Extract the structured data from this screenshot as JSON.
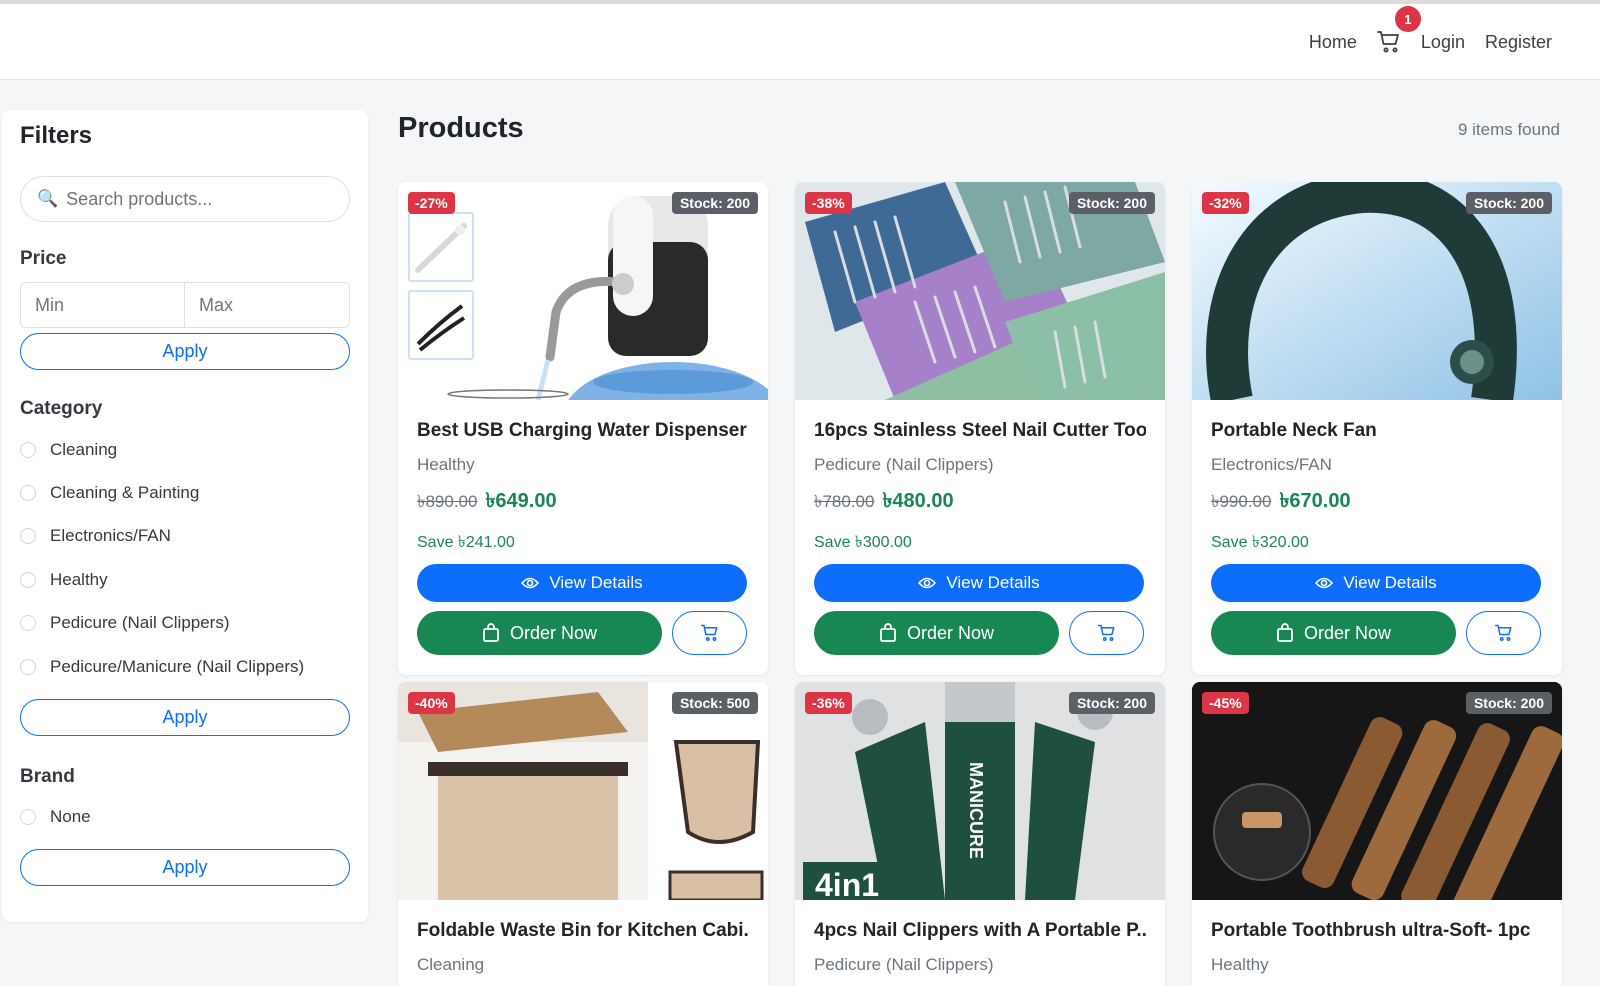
{
  "nav": {
    "home": "Home",
    "login": "Login",
    "register": "Register",
    "cart_count": "1"
  },
  "filters": {
    "title": "Filters",
    "search_placeholder": "Search products...",
    "price_label": "Price",
    "min_placeholder": "Min",
    "max_placeholder": "Max",
    "apply": "Apply",
    "category_label": "Category",
    "categories": [
      "Cleaning",
      "Cleaning & Painting",
      "Electronics/FAN",
      "Healthy",
      "Pedicure (Nail Clippers)",
      "Pedicure/Manicure (Nail Clippers)"
    ],
    "brand_label": "Brand",
    "brands": [
      "None"
    ]
  },
  "main": {
    "title": "Products",
    "items_found": "9 items found"
  },
  "buttons": {
    "view_details": "View Details",
    "order_now": "Order Now"
  },
  "products": [
    {
      "discount": "-27%",
      "stock": "Stock: 200",
      "name": "Best USB Charging Water Dispenser",
      "category": "Healthy",
      "old_price": "৳890.00",
      "price": "৳649.00",
      "save": "Save ৳241.00"
    },
    {
      "discount": "-38%",
      "stock": "Stock: 200",
      "name": "16pcs Stainless Steel Nail Cutter Too...",
      "category": "Pedicure (Nail Clippers)",
      "old_price": "৳780.00",
      "price": "৳480.00",
      "save": "Save ৳300.00"
    },
    {
      "discount": "-32%",
      "stock": "Stock: 200",
      "name": "Portable Neck Fan",
      "category": "Electronics/FAN",
      "old_price": "৳990.00",
      "price": "৳670.00",
      "save": "Save ৳320.00"
    },
    {
      "discount": "-40%",
      "stock": "Stock: 500",
      "name": "Foldable Waste Bin for Kitchen Cabi...",
      "category": "Cleaning"
    },
    {
      "discount": "-36%",
      "stock": "Stock: 200",
      "name": "4pcs Nail Clippers with A Portable P...",
      "category": "Pedicure (Nail Clippers)"
    },
    {
      "discount": "-45%",
      "stock": "Stock: 200",
      "name": "Portable Toothbrush ultra-Soft- 1pc",
      "category": "Healthy"
    }
  ],
  "image_text": {
    "manicure": "MANICURE",
    "four_in_one": "4in1"
  }
}
